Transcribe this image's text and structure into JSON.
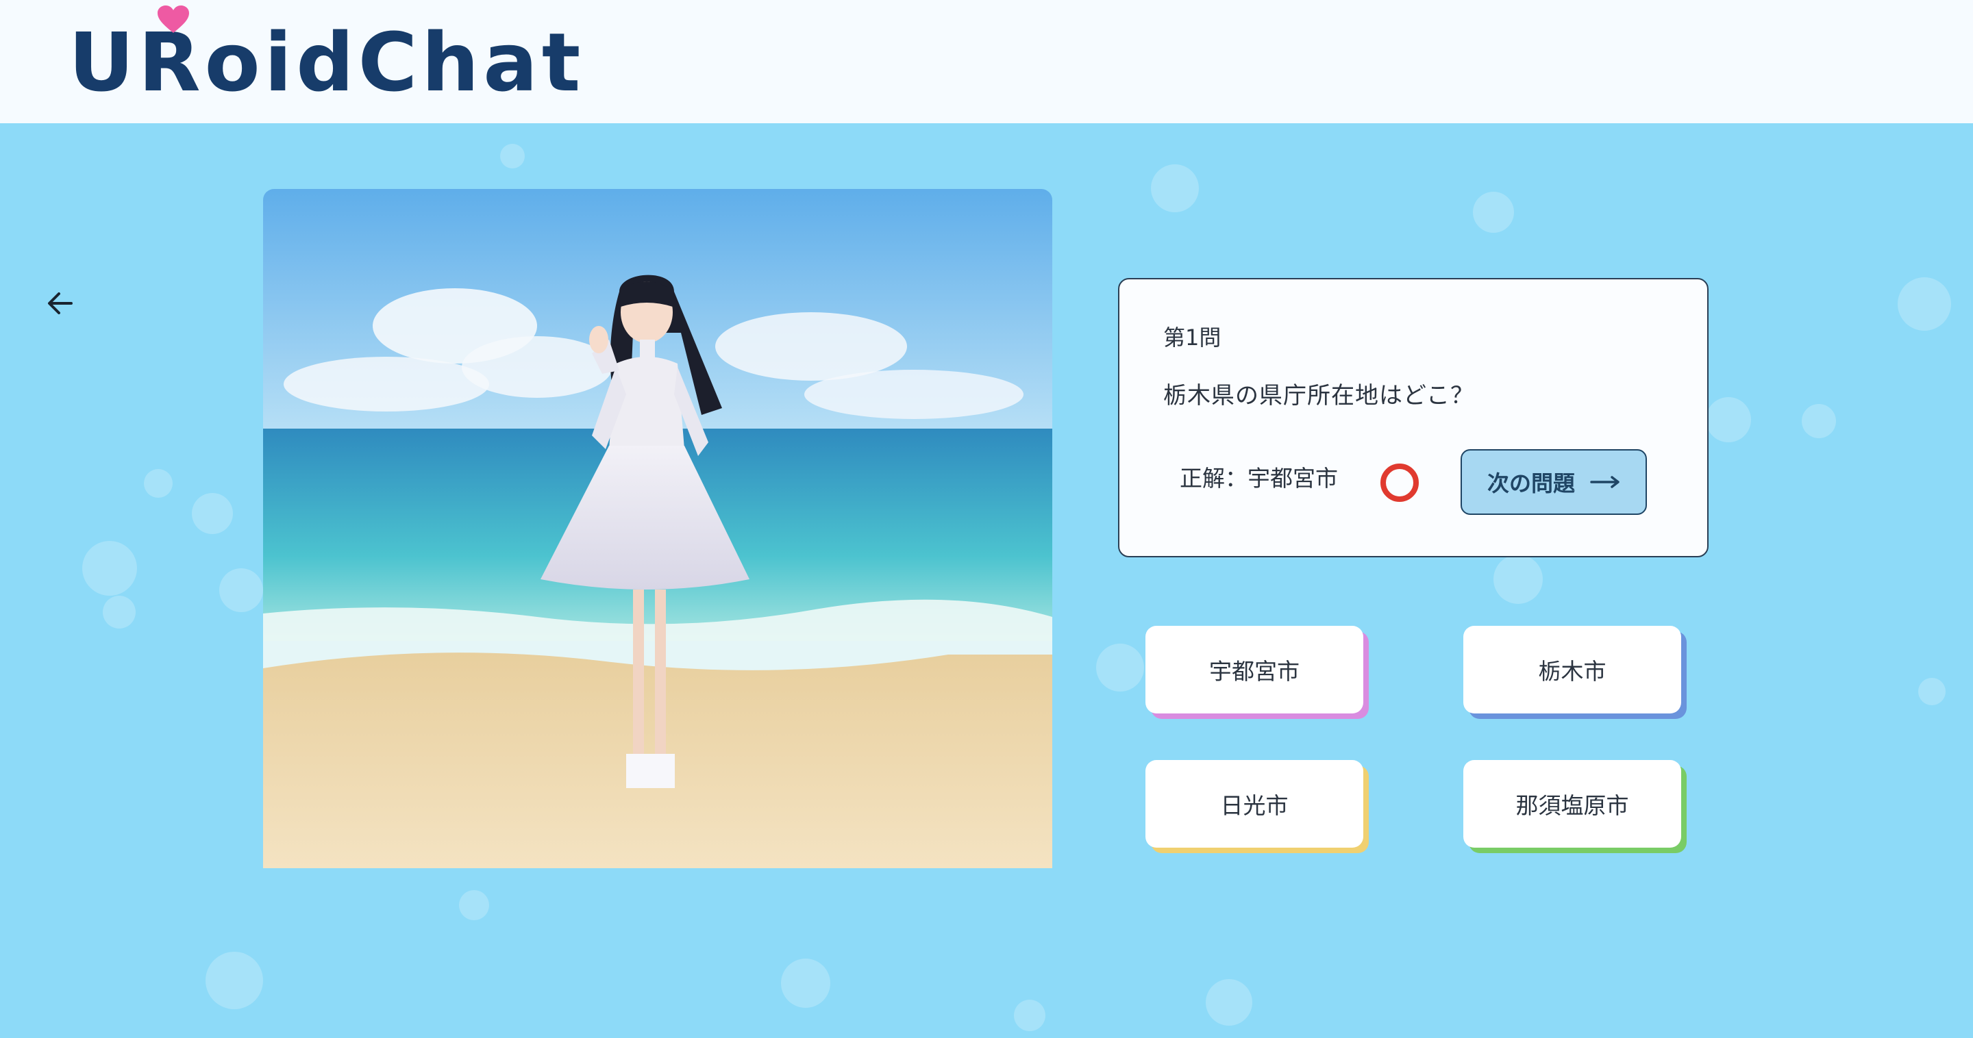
{
  "app": {
    "logo_text": "URoidChat"
  },
  "quiz": {
    "question_number": "第1問",
    "question_text": "栃木県の県庁所在地はどこ？",
    "answer_prefix": "正解：",
    "answer_value": "宇都宮市",
    "result": "correct",
    "next_button_label": "次の問題",
    "choices": [
      "宇都宮市",
      "栃木市",
      "日光市",
      "那須塩原市"
    ]
  },
  "colors": {
    "brand": "#173c6a",
    "background": "#8ddaf8",
    "correct_mark": "#e03a2f",
    "choice_accents": [
      "#d98ce0",
      "#6a93dc",
      "#f0d070",
      "#79cc66"
    ]
  },
  "icons": {
    "back": "arrow-left-icon",
    "next": "arrow-right-icon",
    "correct": "circle-mark-icon",
    "logo_heart": "heart-icon"
  }
}
